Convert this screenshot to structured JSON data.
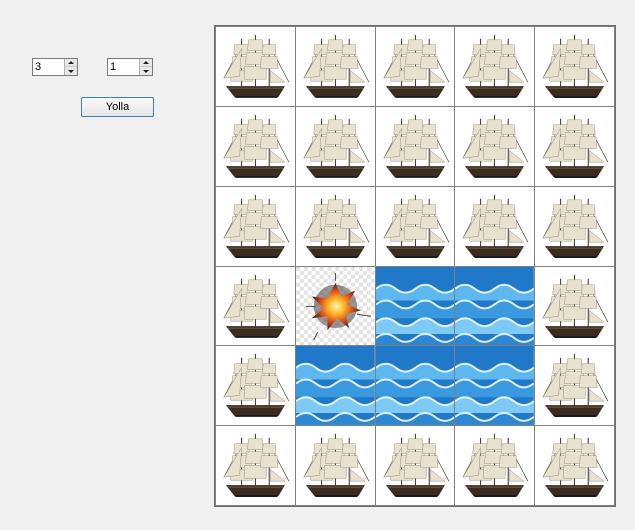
{
  "controls": {
    "row_value": "3",
    "col_value": "1",
    "send_label": "Yolla"
  },
  "board": {
    "rows": 6,
    "cols": 5,
    "cells": [
      [
        "ship",
        "ship",
        "ship",
        "ship",
        "ship"
      ],
      [
        "ship",
        "ship",
        "ship",
        "ship",
        "ship"
      ],
      [
        "ship",
        "ship",
        "ship",
        "ship",
        "ship"
      ],
      [
        "ship",
        "explosion",
        "sea",
        "sea",
        "ship"
      ],
      [
        "ship",
        "sea",
        "sea",
        "sea",
        "ship"
      ],
      [
        "ship",
        "ship",
        "ship",
        "ship",
        "ship"
      ]
    ],
    "icons": {
      "ship": "sailing-ship-icon",
      "explosion": "explosion-icon",
      "sea": "sea-waves-icon"
    }
  }
}
